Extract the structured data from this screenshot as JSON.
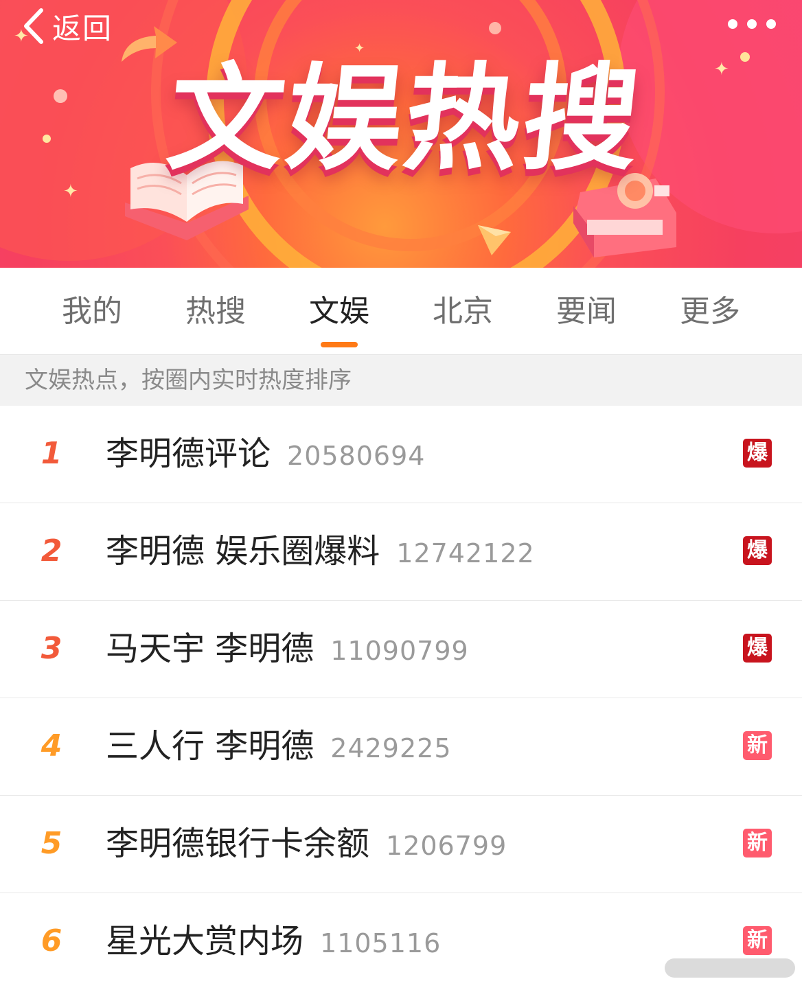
{
  "header": {
    "back_label": "返回",
    "banner_title": "文娱热搜"
  },
  "tabs": [
    {
      "label": "我的",
      "active": false
    },
    {
      "label": "热搜",
      "active": false
    },
    {
      "label": "文娱",
      "active": true
    },
    {
      "label": "北京",
      "active": false
    },
    {
      "label": "要闻",
      "active": false
    },
    {
      "label": "更多",
      "active": false
    }
  ],
  "info_text": "文娱热点，按圈内实时热度排序",
  "items": [
    {
      "rank": "1",
      "title": "李明德评论",
      "count": "20580694",
      "badge": "爆"
    },
    {
      "rank": "2",
      "title": "李明德 娱乐圈爆料",
      "count": "12742122",
      "badge": "爆"
    },
    {
      "rank": "3",
      "title": "马天宇 李明德",
      "count": "11090799",
      "badge": "爆"
    },
    {
      "rank": "4",
      "title": "三人行 李明德",
      "count": "2429225",
      "badge": "新"
    },
    {
      "rank": "5",
      "title": "李明德银行卡余额",
      "count": "1206799",
      "badge": "新"
    },
    {
      "rank": "6",
      "title": "星光大赏内场",
      "count": "1105116",
      "badge": "新"
    }
  ],
  "colors": {
    "accent_underline": "#ff7a16",
    "rank_top": "#f25a3a",
    "rank_other": "#ff9b26",
    "badge_hot": "#c8141e",
    "badge_new": "#ff5b6e"
  }
}
